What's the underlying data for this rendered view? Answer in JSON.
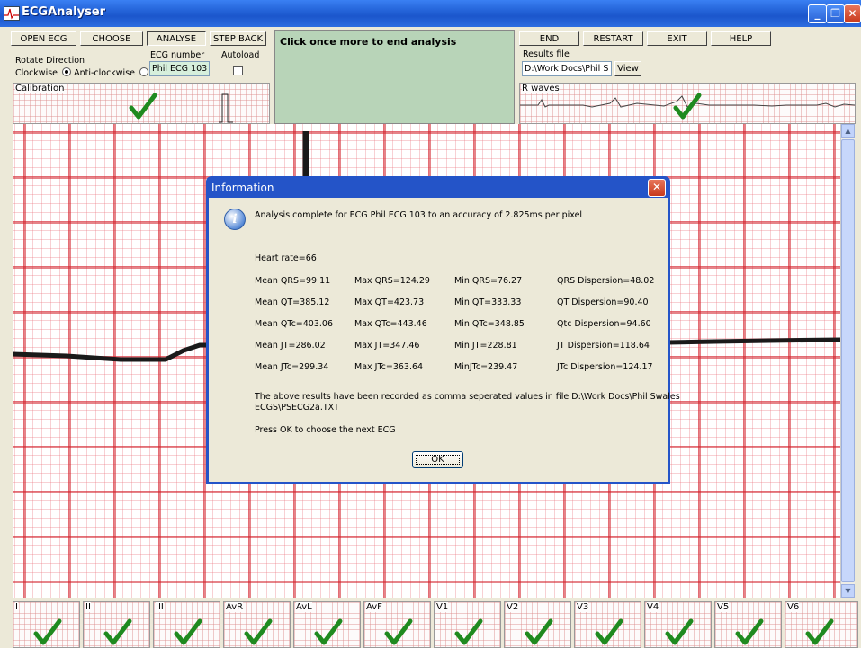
{
  "window": {
    "title": "ECGAnalyser",
    "minimize": "_",
    "maximize": "❐",
    "close": "✕"
  },
  "toolbar": {
    "open_ecg": "OPEN ECG",
    "choose": "CHOOSE",
    "analyse": "ANALYSE",
    "step_back": "STEP BACK",
    "end": "END",
    "restart": "RESTART",
    "exit": "EXIT",
    "help": "HELP",
    "rotate_direction_label": "Rotate Direction",
    "clockwise_label": "Clockwise",
    "anticlockwise_label": "Anti-clockwise",
    "rotate_selected": "clockwise",
    "ecg_number_label": "ECG number",
    "ecg_number_value": "Phil ECG 103",
    "autoload_label": "Autoload",
    "autoload_checked": false,
    "status_message": "Click once more to end analysis",
    "results_file_label": "Results file",
    "results_file_value": "D:\\Work Docs\\Phil S",
    "view_button": "View",
    "calibration_label": "Calibration",
    "r_waves_label": "R waves"
  },
  "dialog": {
    "title": "Information",
    "icon": "info-icon",
    "intro": "Analysis complete for ECG Phil ECG 103 to an accuracy of 2.825ms per pixel",
    "heart_rate": "Heart rate=66",
    "results": [
      [
        "Mean QRS=99.11",
        "Max QRS=124.29",
        "Min QRS=76.27",
        "QRS Dispersion=48.02"
      ],
      [
        "Mean QT=385.12",
        "Max QT=423.73",
        "Min QT=333.33",
        "QT Dispersion=90.40"
      ],
      [
        "Mean QTc=403.06",
        "Max QTc=443.46",
        "Min QTc=348.85",
        "Qtc Dispersion=94.60"
      ],
      [
        "Mean JT=286.02",
        "Max JT=347.46",
        "Min JT=228.81",
        "JT Dispersion=118.64"
      ],
      [
        "Mean JTc=299.34",
        "Max JTc=363.64",
        "MinJTc=239.47",
        "JTc Dispersion=124.17"
      ]
    ],
    "recorded_line1": "The above results have been recorded as comma seperated values in file D:\\Work Docs\\Phil Swales",
    "recorded_line2": "ECGS\\PSECG2a.TXT",
    "press_ok": "Press OK to choose the next ECG",
    "ok": "OK"
  },
  "leads": [
    "I",
    "II",
    "III",
    "AvR",
    "AvL",
    "AvF",
    "V1",
    "V2",
    "V3",
    "V4",
    "V5",
    "V6"
  ],
  "colors": {
    "check": "#1f8a1f",
    "grid_major": "#d21e28",
    "status_panel": "#b8d4b8",
    "field_bg": "#d6efdc"
  }
}
